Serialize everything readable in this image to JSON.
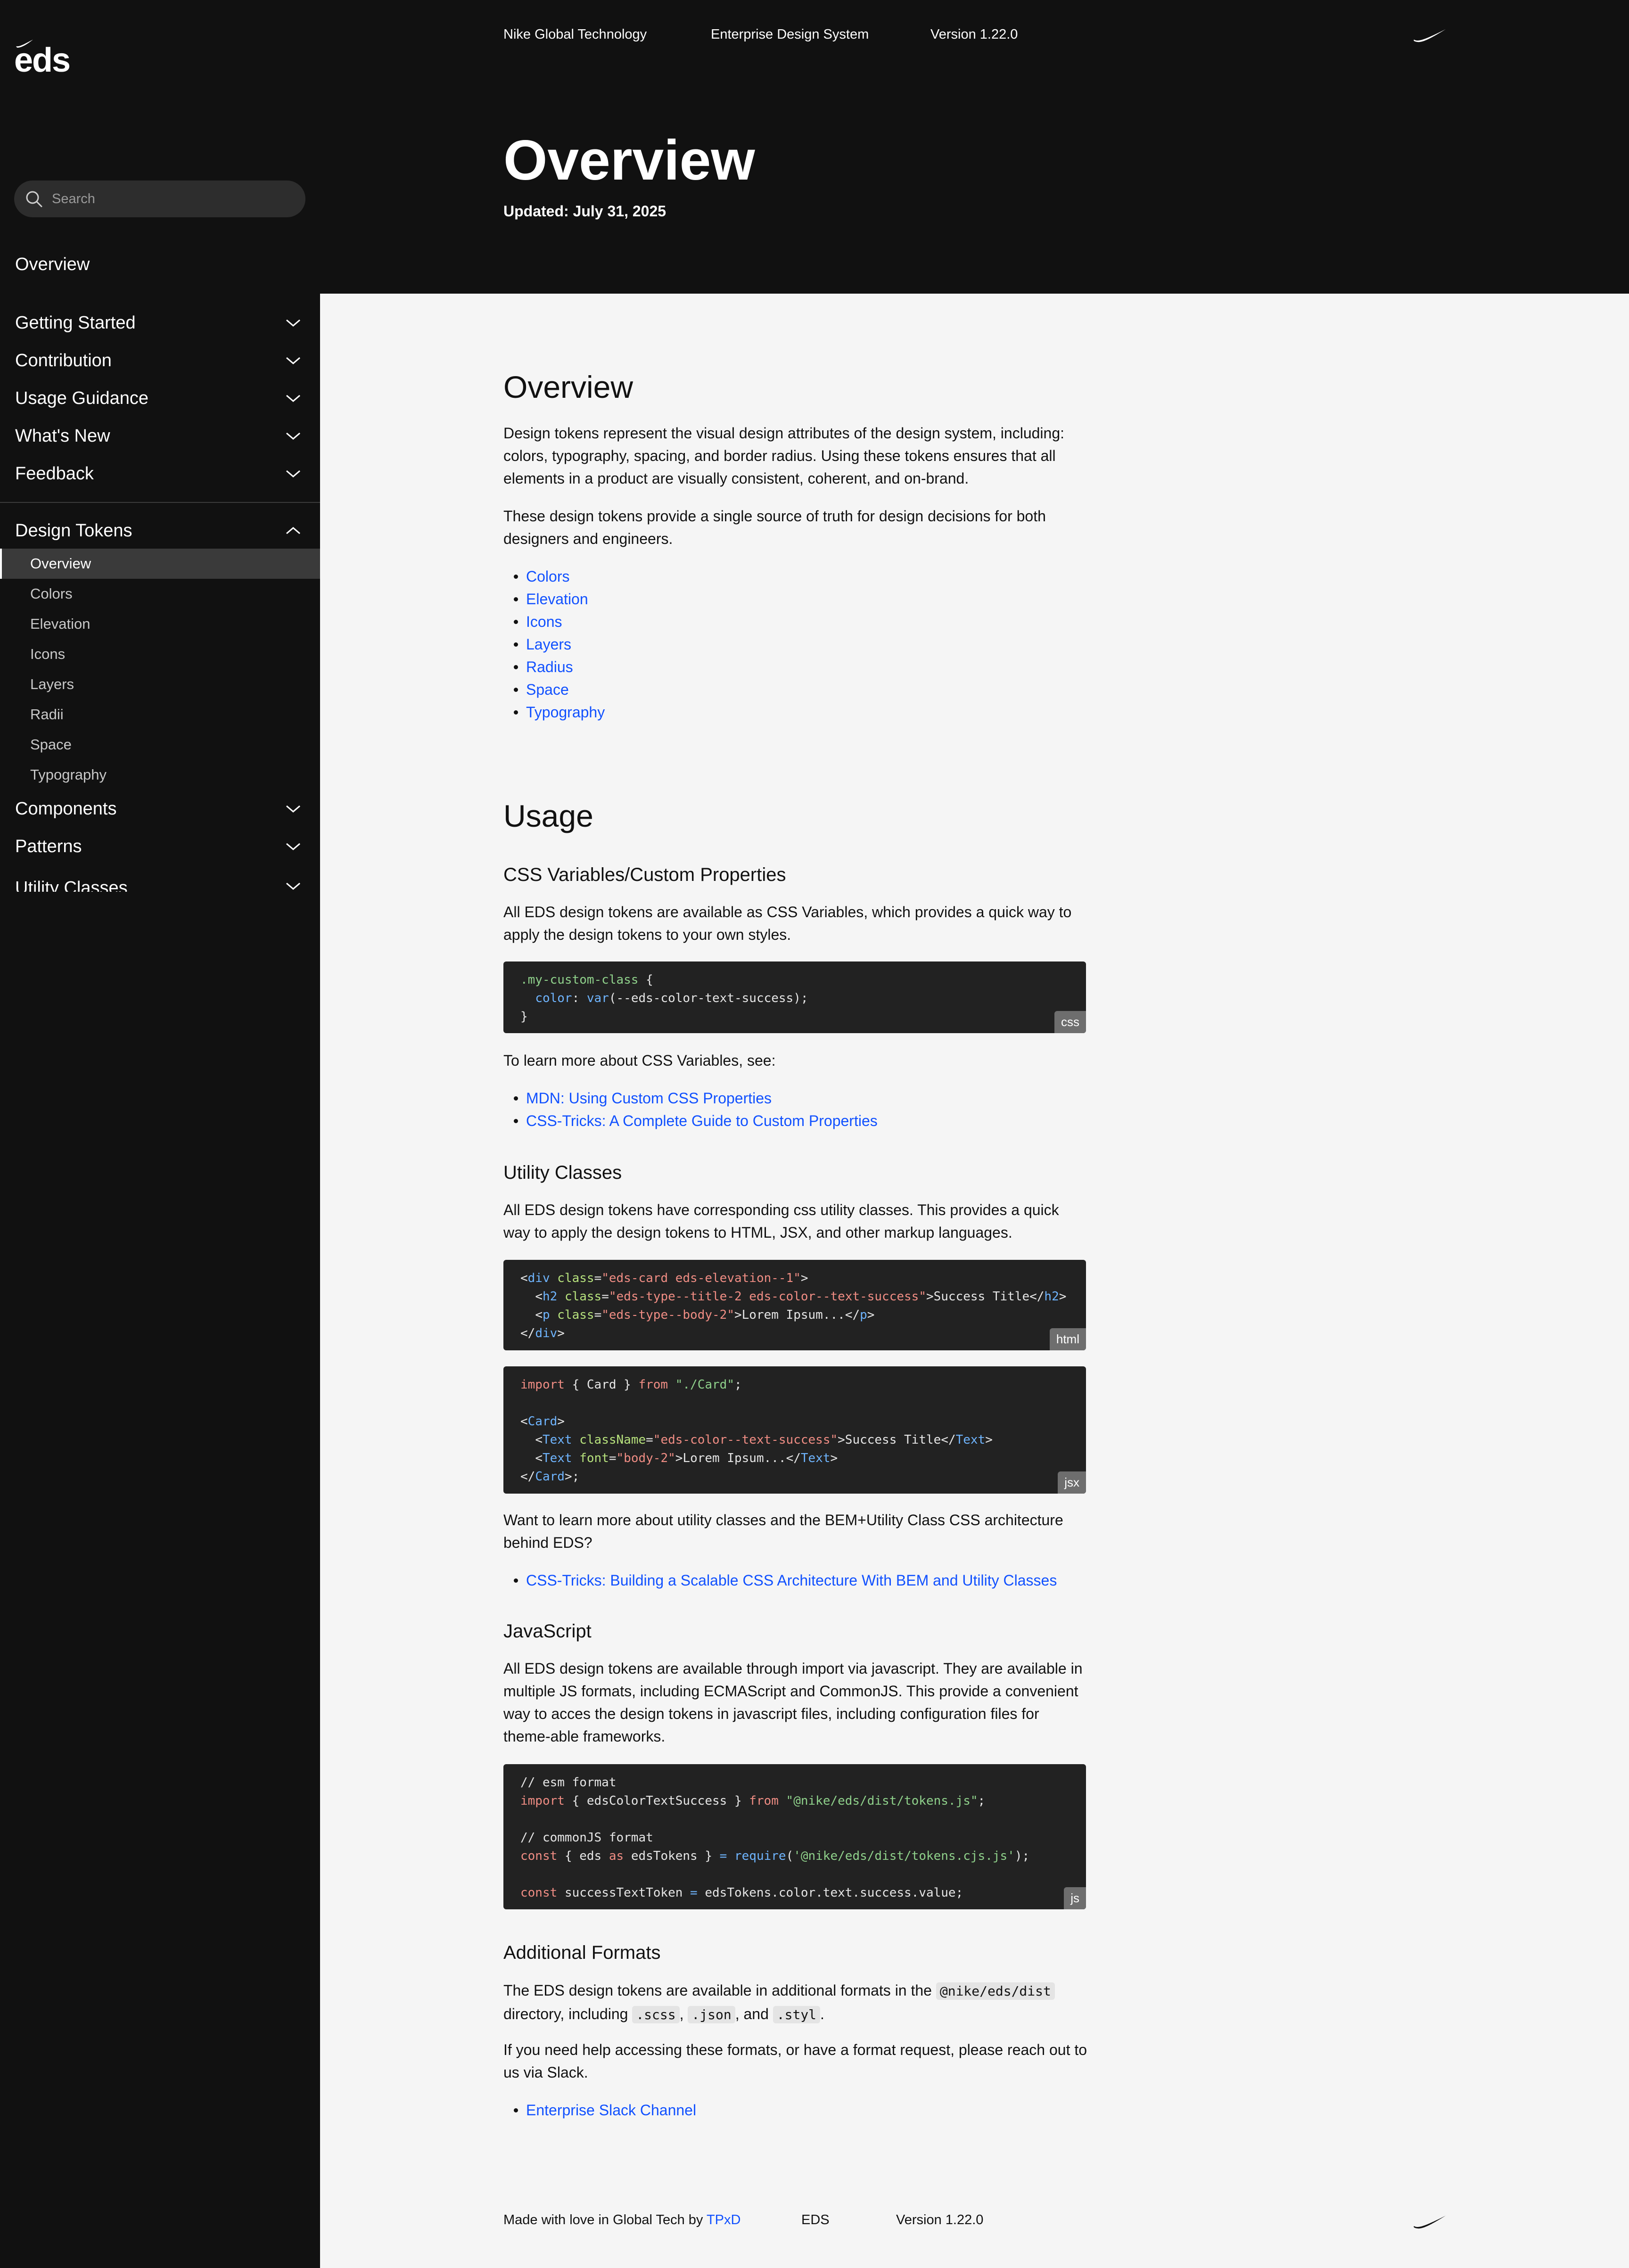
{
  "sidebar": {
    "logo": "eds",
    "search_placeholder": "Search",
    "overview": "Overview",
    "groups": [
      "Getting Started",
      "Contribution",
      "Usage Guidance",
      "What's New",
      "Feedback"
    ],
    "design_tokens": "Design Tokens",
    "design_tokens_items": [
      "Overview",
      "Colors",
      "Elevation",
      "Icons",
      "Layers",
      "Radii",
      "Space",
      "Typography"
    ],
    "after_groups": [
      "Components",
      "Patterns",
      "Utility Classes"
    ]
  },
  "header": {
    "nav": [
      "Nike Global Technology",
      "Enterprise Design System",
      "Version 1.22.0"
    ],
    "title": "Overview",
    "updated": "Updated: July 31, 2025"
  },
  "main": {
    "overview_heading": "Overview",
    "overview_p1": "Design tokens represent the visual design attributes of the design system, including: colors, typography, spacing, and border radius. Using these tokens ensures that all elements in a product are visually consistent, coherent, and on-brand.",
    "overview_p2": "These design tokens provide a single source of truth for design decisions for both designers and engineers.",
    "token_links": [
      "Colors",
      "Elevation",
      "Icons",
      "Layers",
      "Radius",
      "Space",
      "Typography"
    ],
    "usage_heading": "Usage",
    "css_vars_heading": "CSS Variables/Custom Properties",
    "css_vars_p": "All EDS design tokens are available as CSS Variables, which provides a quick way to apply the design tokens to your own styles.",
    "css_lang": "css",
    "css_learn": "To learn more about CSS Variables, see:",
    "css_links": [
      "MDN: Using Custom CSS Properties",
      "CSS-Tricks: A Complete Guide to Custom Properties"
    ],
    "utility_heading": "Utility Classes",
    "utility_p": "All EDS design tokens have corresponding css utility classes. This provides a quick way to apply the design tokens to HTML, JSX, and other markup languages.",
    "html_lang": "html",
    "jsx_lang": "jsx",
    "utility_learn": "Want to learn more about utility classes and the BEM+Utility Class CSS architecture behind EDS?",
    "utility_links": [
      "CSS-Tricks: Building a Scalable CSS Architecture With BEM and Utility Classes"
    ],
    "js_heading": "JavaScript",
    "js_p": "All EDS design tokens are available through import via javascript. They are available in multiple JS formats, including ECMAScript and CommonJS. This provide a convenient way to acces the design tokens in javascript files, including configuration files for theme-able frameworks.",
    "js_lang": "js",
    "formats_heading": "Additional Formats",
    "formats_p1_a": "The EDS design tokens are available in additional formats in the",
    "formats_code_dist": "@nike/eds/dist",
    "formats_p1_b": "directory, including",
    "formats_code_scss": ".scss",
    "formats_code_json": ".json",
    "formats_and": ", and",
    "formats_code_styl": ".styl",
    "formats_p2": "If you need help accessing these formats, or have a format request, please reach out to us via Slack.",
    "formats_links": [
      "Enterprise Slack Channel"
    ]
  },
  "footer": {
    "made_with": "Made with love in Global Tech by",
    "team_link": "TPxD",
    "eds": "EDS",
    "version": "Version 1.22.0"
  },
  "colors": {
    "sidebar_bg": "#111111",
    "page_bg": "#f5f5f5",
    "link": "#1151ff",
    "code_bg": "#222222"
  }
}
